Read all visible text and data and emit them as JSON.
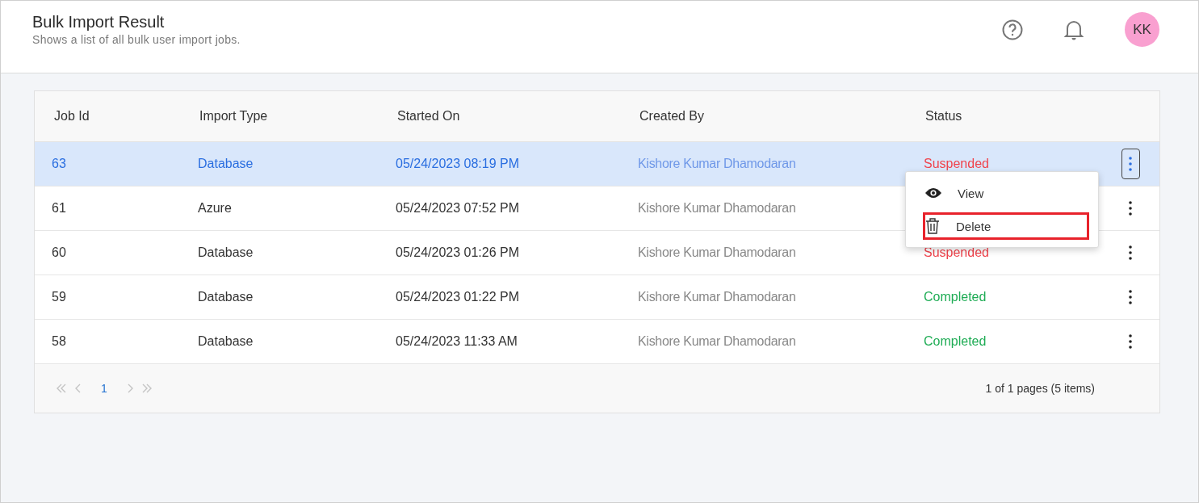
{
  "header": {
    "title": "Bulk Import Result",
    "subtitle": "Shows a list of all bulk user import jobs.",
    "avatar": "KK"
  },
  "table": {
    "columns": [
      "Job Id",
      "Import Type",
      "Started On",
      "Created By",
      "Status"
    ],
    "rows": [
      {
        "job_id": "63",
        "import_type": "Database",
        "started_on": "05/24/2023 08:19 PM",
        "created_by": "Kishore Kumar Dhamodaran",
        "status": "Suspended",
        "color": "#f0434c",
        "selected": true,
        "menu_open": true
      },
      {
        "job_id": "61",
        "import_type": "Azure",
        "started_on": "05/24/2023 07:52 PM",
        "created_by": "Kishore Kumar Dhamodaran",
        "selected": false,
        "menu_open": false
      },
      {
        "job_id": "60",
        "import_type": "Database",
        "started_on": "05/24/2023 01:26 PM",
        "created_by": "Kishore Kumar Dhamodaran",
        "status": "Suspended",
        "color": "#f0434c",
        "selected": false,
        "menu_open": false
      },
      {
        "job_id": "59",
        "import_type": "Database",
        "started_on": "05/24/2023 01:22 PM",
        "created_by": "Kishore Kumar Dhamodaran",
        "status": "Completed",
        "color": "#1fac55",
        "selected": false,
        "menu_open": false
      },
      {
        "job_id": "58",
        "import_type": "Database",
        "started_on": "05/24/2023 11:33 AM",
        "created_by": "Kishore Kumar Dhamodaran",
        "status": "Completed",
        "color": "#1fac55",
        "selected": false,
        "menu_open": false
      }
    ]
  },
  "context_menu": {
    "items": [
      {
        "kind": "view",
        "label": "View",
        "highlighted": false
      },
      {
        "kind": "delete",
        "label": "Delete",
        "highlighted": true
      }
    ]
  },
  "pager": {
    "nav_disabled": true,
    "pages": [
      {
        "label": "1",
        "selected": true
      }
    ],
    "summary": "1 of 1 pages (5 items)"
  }
}
